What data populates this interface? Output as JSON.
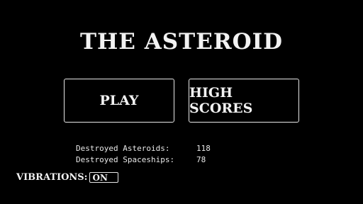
{
  "game": {
    "title": "THE ASTEROID"
  },
  "menu": {
    "play_label": "PLAY",
    "high_scores_label": "HIGH SCORES"
  },
  "stats": {
    "destroyed_asteroids_label": "Destroyed Asteroids:",
    "destroyed_asteroids_value": "118",
    "destroyed_spaceships_label": "Destroyed Spaceships:",
    "destroyed_spaceships_value": "78"
  },
  "settings": {
    "vibrations_label": "VIBRATIONS:",
    "vibrations_state": "ON"
  },
  "colors": {
    "background": "#000000",
    "foreground": "#f2f2f2"
  }
}
